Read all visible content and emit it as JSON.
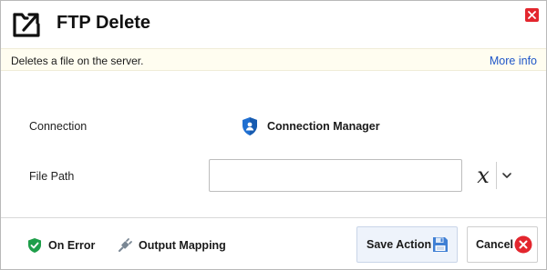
{
  "dialog": {
    "title": "FTP Delete",
    "header_icon": "folder-arrow-icon",
    "close_icon": "close-icon"
  },
  "info": {
    "description": "Deletes a file on the server.",
    "more_link": "More info"
  },
  "fields": {
    "connection": {
      "label": "Connection",
      "value": "Connection Manager",
      "icon": "shield-user-icon"
    },
    "file_path": {
      "label": "File Path",
      "value": "",
      "placeholder": "",
      "variable_icon": "variable-x-icon",
      "dropdown_icon": "chevron-down-icon"
    }
  },
  "footer": {
    "on_error": "On Error",
    "output_mapping": "Output Mapping",
    "save_label": "Save Action",
    "cancel_label": "Cancel"
  },
  "colors": {
    "accent_link": "#1f56c8",
    "info_bar_bg": "#fffdf0",
    "close_red": "#e3262e",
    "save_bg": "#eef3fb",
    "on_error_green": "#1e9e4a",
    "shield_blue": "#1f6fd1"
  }
}
